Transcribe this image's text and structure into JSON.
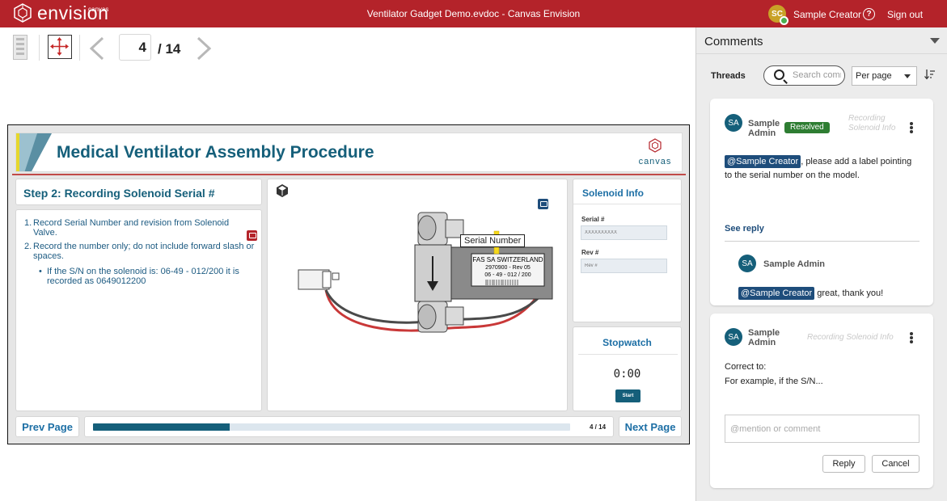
{
  "app": {
    "brand": "envision",
    "brand_sup": "canvas",
    "window_title": "Ventilator Gadget Demo.evdoc - Canvas Envision",
    "user_initials": "SC",
    "user_name": "Sample Creator",
    "help": "?",
    "sign_out": "Sign out",
    "colors": {
      "topbar": "#b4232a",
      "accent": "#155f7a",
      "mention": "#1e4d7b",
      "resolved": "#2e7d32"
    }
  },
  "viewer": {
    "current_page": "4",
    "total_pages": "/ 14",
    "prev_icon": "chevron-left-icon",
    "next_icon": "chevron-right-icon"
  },
  "document": {
    "title": "Medical Ventilator Assembly Procedure",
    "logo_text": "canvas",
    "step_title": "Step 2: Recording Solenoid Serial #",
    "instructions": [
      {
        "num": "1.",
        "text": "Record Serial Number and revision from Solenoid Valve."
      },
      {
        "num": "2.",
        "text": "Record the number only; do not include forward slash or spaces."
      }
    ],
    "sub_instruction": "If the S/N on the solenoid is: 06-49 - 012/200 it is recorded as 0649012200",
    "model": {
      "callout": "Serial Number",
      "plate_line1": "FAS SA SWITZERLAND",
      "plate_line2": "2970900 - Rev 05",
      "plate_line3": "06 - 49  -  012 / 200"
    },
    "solenoid_info": {
      "title": "Solenoid Info",
      "serial_label": "Serial #",
      "serial_placeholder": "XXXXXXXXXX",
      "rev_label": "Rev #",
      "rev_placeholder": "Rev #"
    },
    "stopwatch": {
      "title": "Stopwatch",
      "time": "0:00",
      "start": "Start"
    },
    "nav": {
      "prev": "Prev Page",
      "next": "Next Page",
      "progress_text": "4 / 14",
      "progress_fraction": 0.2857
    }
  },
  "comments": {
    "title": "Comments",
    "threads_label": "Threads",
    "search_placeholder": "Search comments",
    "per_page": "Per page",
    "threads": [
      {
        "initials": "SA",
        "author": "Sample Admin",
        "status": "Resolved",
        "context": "Recording Solenoid Info",
        "mention": "@Sample Creator",
        "message": ", please add a label pointing to the serial number on the model.",
        "see_reply": "See reply",
        "reply": {
          "initials": "SA",
          "author": "Sample Admin",
          "mention": "@Sample Creator",
          "message": " great, thank you!"
        }
      },
      {
        "initials": "SA",
        "author": "Sample Admin",
        "context": "Recording Solenoid Info",
        "message_line1": "Correct to:",
        "message_line2": "For example, if the S/N...",
        "input_placeholder": "@mention or comment",
        "reply_button": "Reply",
        "cancel_button": "Cancel"
      }
    ]
  }
}
